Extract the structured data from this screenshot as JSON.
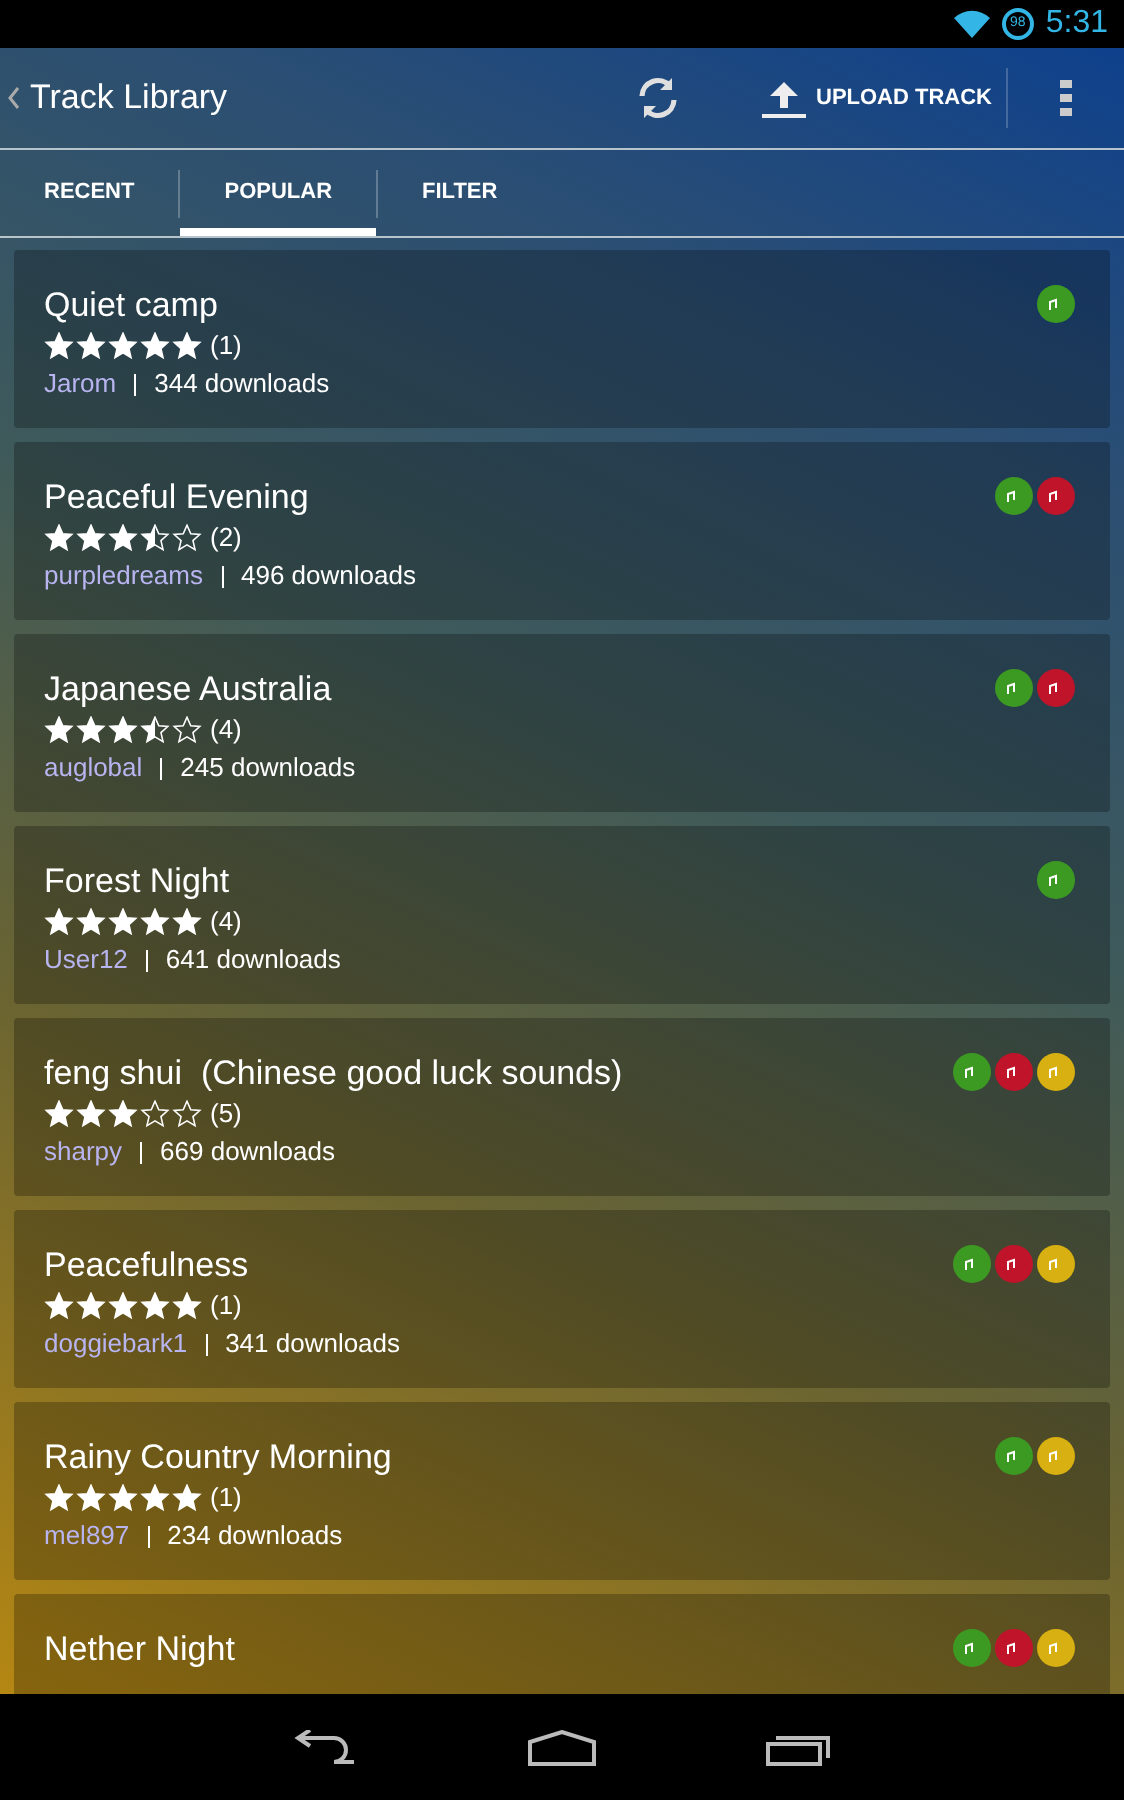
{
  "status_bar": {
    "battery": "98",
    "time": "5:31"
  },
  "action_bar": {
    "title": "Track Library",
    "upload_label": "UPLOAD TRACK"
  },
  "tabs": [
    {
      "label": "RECENT",
      "selected": false
    },
    {
      "label": "POPULAR",
      "selected": true
    },
    {
      "label": "FILTER",
      "selected": false
    }
  ],
  "tracks": [
    {
      "title": "Quiet camp",
      "stars": 5,
      "count": "(1)",
      "author": "Jarom",
      "downloads": "344 downloads",
      "badges": [
        {
          "color": "#3c9a23"
        }
      ]
    },
    {
      "title": "Peaceful Evening",
      "stars": 3.5,
      "count": "(2)",
      "author": "purpledreams",
      "downloads": "496 downloads",
      "badges": [
        {
          "color": "#3c9a23"
        },
        {
          "color": "#c0142a"
        }
      ]
    },
    {
      "title": "Japanese Australia",
      "stars": 3.5,
      "count": "(4)",
      "author": "auglobal",
      "downloads": "245 downloads",
      "badges": [
        {
          "color": "#3c9a23"
        },
        {
          "color": "#c0142a"
        }
      ]
    },
    {
      "title": "Forest Night",
      "stars": 5,
      "count": "(4)",
      "author": "User12",
      "downloads": "641 downloads",
      "badges": [
        {
          "color": "#3c9a23"
        }
      ]
    },
    {
      "title": "feng shui  (Chinese good luck sounds)",
      "stars": 3,
      "count": "(5)",
      "author": "sharpy",
      "downloads": "669 downloads",
      "badges": [
        {
          "color": "#3c9a23"
        },
        {
          "color": "#c0142a"
        },
        {
          "color": "#d8b012"
        }
      ]
    },
    {
      "title": "Peacefulness",
      "stars": 5,
      "count": "(1)",
      "author": "doggiebark1",
      "downloads": "341 downloads",
      "badges": [
        {
          "color": "#3c9a23"
        },
        {
          "color": "#c0142a"
        },
        {
          "color": "#d8b012"
        }
      ]
    },
    {
      "title": "Rainy Country Morning",
      "stars": 5,
      "count": "(1)",
      "author": "mel897",
      "downloads": "234 downloads",
      "badges": [
        {
          "color": "#3c9a23"
        },
        {
          "color": "#d8b012"
        }
      ]
    },
    {
      "title": "Nether Night",
      "badges": [
        {
          "color": "#3c9a23"
        },
        {
          "color": "#c0142a"
        },
        {
          "color": "#d8b012"
        }
      ]
    }
  ]
}
